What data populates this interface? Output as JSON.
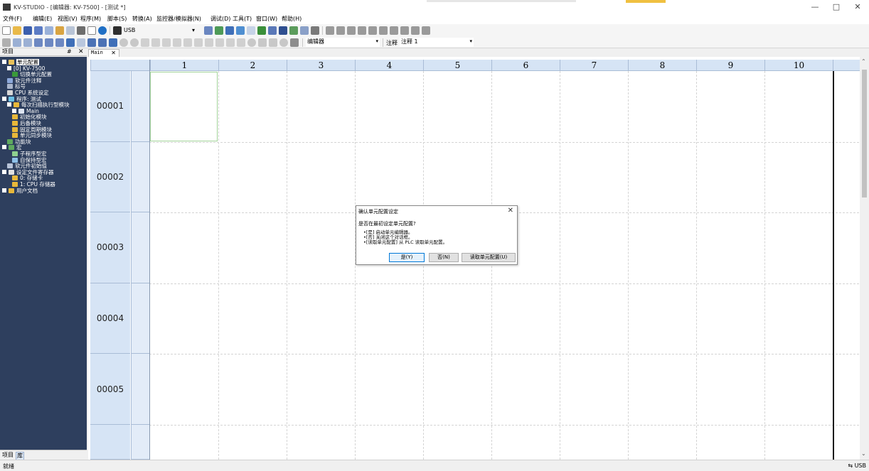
{
  "window": {
    "title": "KV-STUDIO - [编辑器: KV-7500] - [测试 *]",
    "minimize": "—",
    "maximize": "□",
    "close": "✕"
  },
  "menu": [
    "文件(F)",
    "编辑(E)",
    "视图(V)",
    "程序(M)",
    "脚本(S)",
    "转换(A)",
    "监控器/模拟器(N)",
    "调试(D)",
    "工具(T)",
    "窗口(W)",
    "帮助(H)"
  ],
  "toolbar": {
    "connection_label": "USB",
    "mode_combo": "编辑器",
    "comment_label": "注释",
    "comment_combo": "注释 1"
  },
  "project_panel": {
    "title": "项目",
    "pin": "# ",
    "close": "✕",
    "tree": [
      {
        "label": "单元配置",
        "indent": 0,
        "toggle": true,
        "icon": "unit-config-icon",
        "selected": true
      },
      {
        "label": "[0]  KV-7500",
        "indent": 1,
        "toggle": true,
        "icon": ""
      },
      {
        "label": "切换单元配置",
        "indent": 2,
        "toggle": false,
        "icon": "switch-config-icon"
      },
      {
        "label": "软元件注释",
        "indent": 1,
        "toggle": false,
        "icon": "device-comment-icon"
      },
      {
        "label": "标号",
        "indent": 1,
        "toggle": false,
        "icon": "label-icon"
      },
      {
        "label": "CPU 系统设定",
        "indent": 1,
        "toggle": false,
        "icon": "cpu-icon"
      },
      {
        "label": "程序: 测试",
        "indent": 0,
        "toggle": true,
        "icon": "program-icon"
      },
      {
        "label": "每次扫描执行型模块",
        "indent": 1,
        "toggle": true,
        "icon": "folder-icon"
      },
      {
        "label": "Main",
        "indent": 2,
        "toggle": true,
        "icon": "module-icon"
      },
      {
        "label": "初始化模块",
        "indent": 2,
        "toggle": false,
        "icon": "folder-icon"
      },
      {
        "label": "后备模块",
        "indent": 2,
        "toggle": false,
        "icon": "folder-icon"
      },
      {
        "label": "固定周期模块",
        "indent": 2,
        "toggle": false,
        "icon": "folder-icon"
      },
      {
        "label": "单元同步模块",
        "indent": 2,
        "toggle": false,
        "icon": "folder-icon"
      },
      {
        "label": "功能块",
        "indent": 1,
        "toggle": false,
        "icon": "function-block-icon"
      },
      {
        "label": "宏",
        "indent": 0,
        "toggle": true,
        "icon": "macro-icon"
      },
      {
        "label": "子程序型宏",
        "indent": 2,
        "toggle": false,
        "icon": "subroutine-macro-icon"
      },
      {
        "label": "自保持型宏",
        "indent": 2,
        "toggle": false,
        "icon": "self-hold-macro-icon"
      },
      {
        "label": "软元件初始值",
        "indent": 1,
        "toggle": false,
        "icon": "device-init-icon"
      },
      {
        "label": "设定文件寄存器",
        "indent": 0,
        "toggle": true,
        "icon": "file-register-icon"
      },
      {
        "label": "0: 存储卡",
        "indent": 2,
        "toggle": false,
        "icon": "folder-icon"
      },
      {
        "label": "1: CPU 存储器",
        "indent": 2,
        "toggle": false,
        "icon": "folder-icon"
      },
      {
        "label": "用户文档",
        "indent": 0,
        "toggle": true,
        "icon": "user-doc-icon"
      }
    ],
    "footer_tabs": [
      "项目",
      "库"
    ]
  },
  "editor": {
    "tab_label": "Main",
    "tab_close": "✕",
    "columns": [
      "1",
      "2",
      "3",
      "4",
      "5",
      "6",
      "7",
      "8",
      "9",
      "10"
    ],
    "rows": [
      "00001",
      "00002",
      "00003",
      "00004",
      "00005",
      ""
    ]
  },
  "dialog": {
    "title": "确认单元配置设定",
    "close": "✕",
    "question": "是否在最初设定单元配置?",
    "lines": [
      "•[是]    启动单元编辑器。",
      "•[否]    关闭这个对话框。",
      "•[读取单元配置]  从 PLC 读取单元配置。"
    ],
    "buttons": {
      "yes": "是(Y)",
      "no": "否(N)",
      "read": "读取单元配置(U)"
    }
  },
  "status": {
    "left": "就绪",
    "right": "USB"
  },
  "colors": {
    "tree_bg": "#2e3f5e",
    "header_bg": "#d6e4f5",
    "dialog_accent": "#0078d7"
  }
}
